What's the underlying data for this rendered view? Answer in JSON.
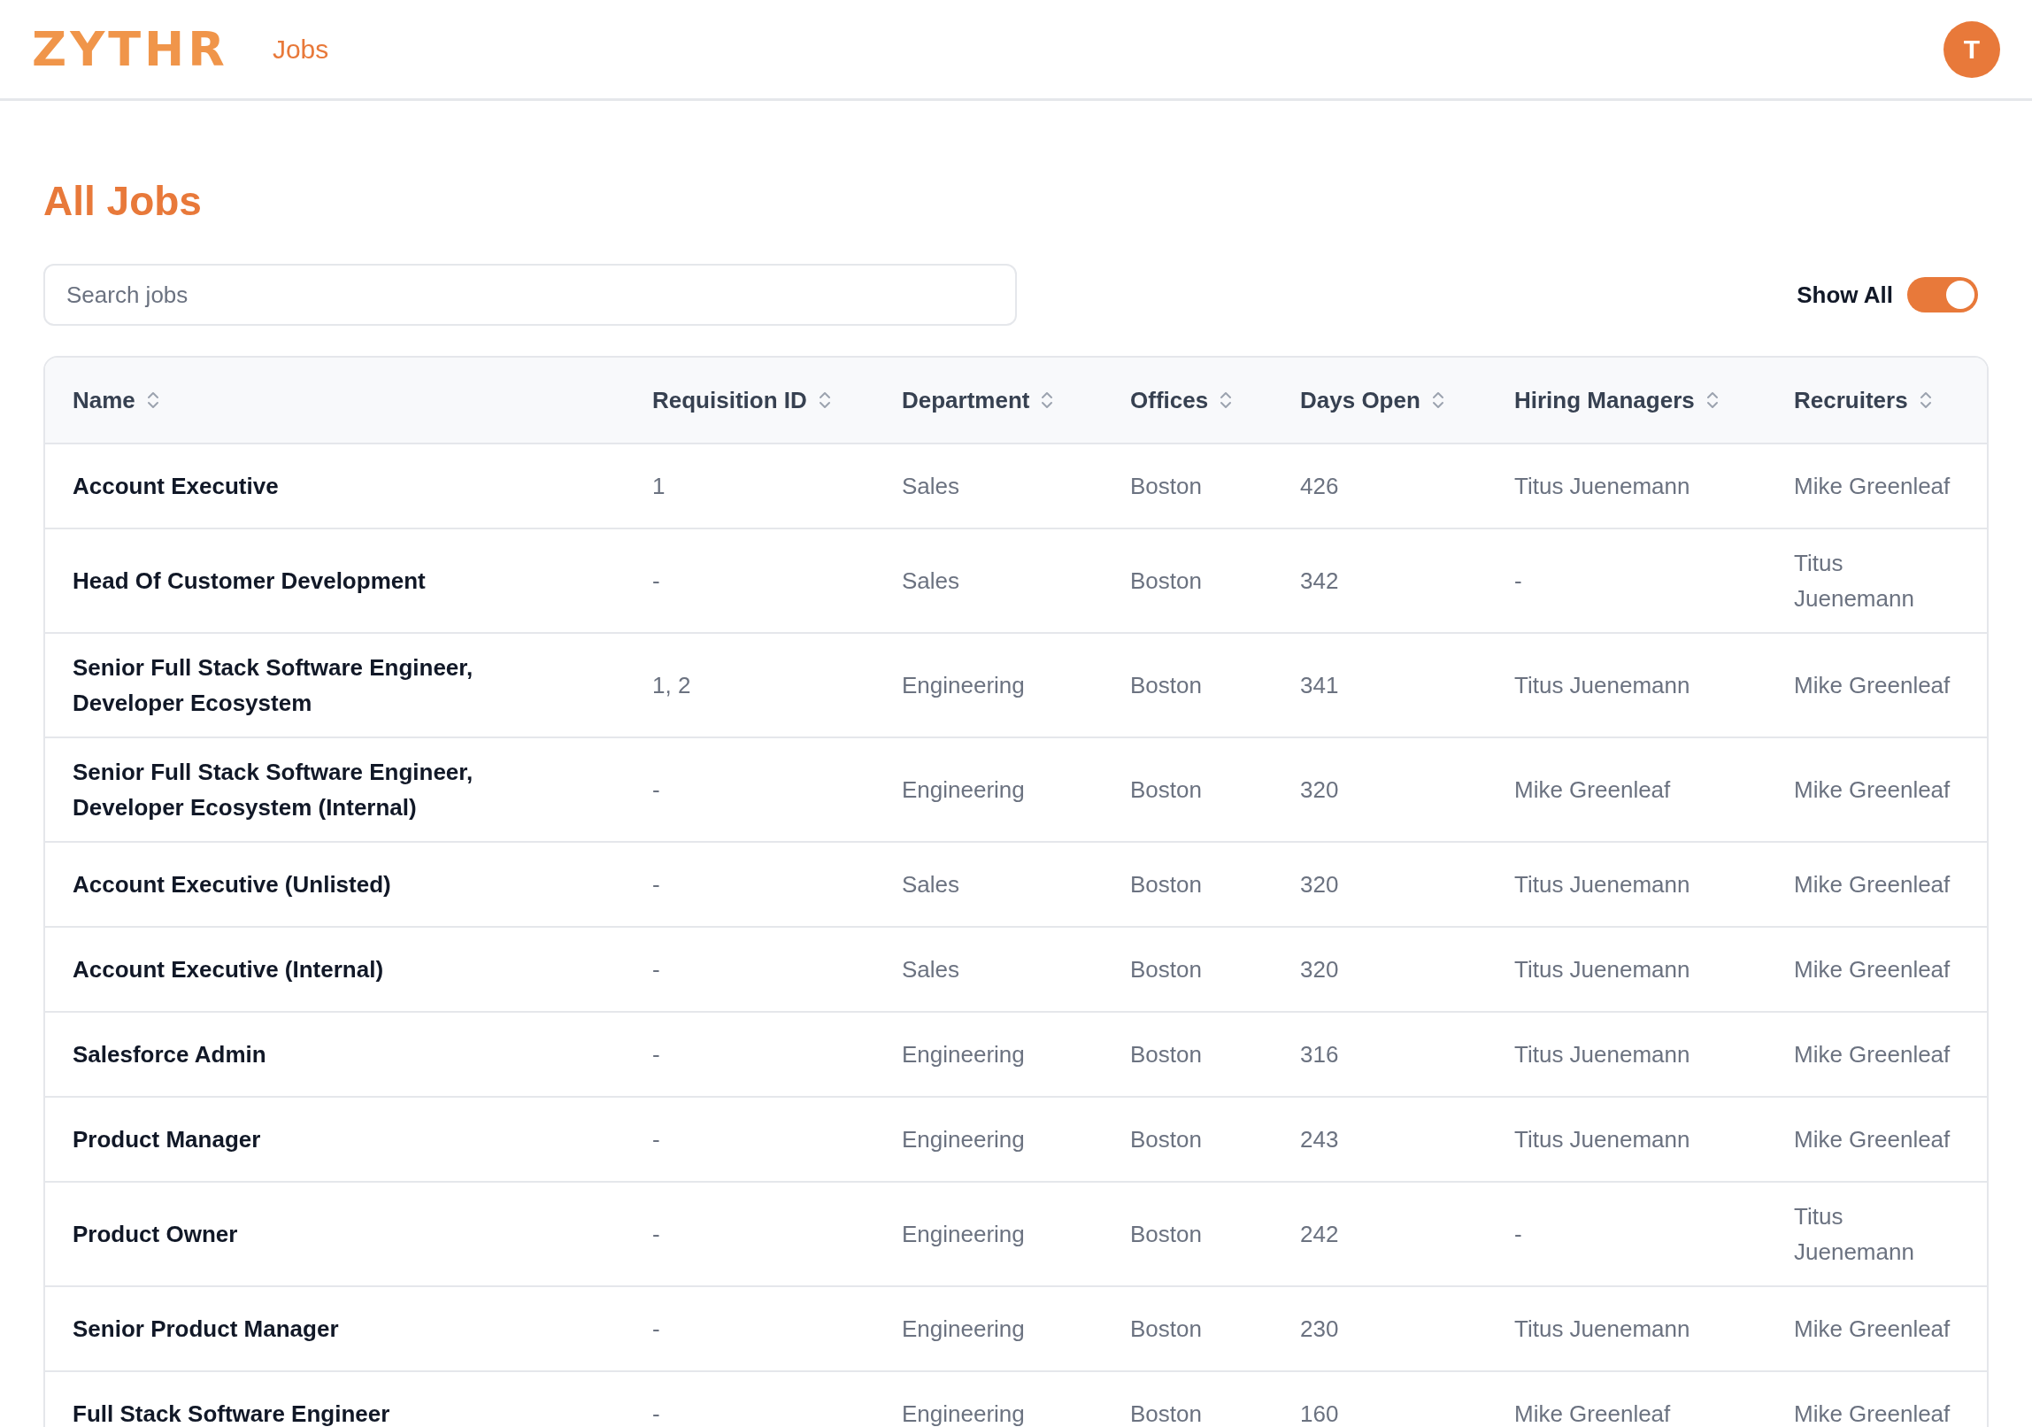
{
  "header": {
    "logo": "ZYTHR",
    "nav": [
      {
        "label": "Jobs",
        "selected": true
      }
    ],
    "avatar": "T"
  },
  "title": "All Jobs",
  "search": {
    "placeholder": "Search jobs"
  },
  "show_all": {
    "label": "Show All",
    "on": true
  },
  "table": {
    "columns": [
      "Name",
      "Requisition ID",
      "Department",
      "Offices",
      "Days Open",
      "Hiring Managers",
      "Recruiters"
    ],
    "rows": [
      [
        "Account Executive",
        "1",
        "Sales",
        "Boston",
        "426",
        "Titus Juenemann",
        "Mike Greenleaf"
      ],
      [
        "Head Of Customer Development",
        "-",
        "Sales",
        "Boston",
        "342",
        "-",
        "Titus Juenemann"
      ],
      [
        "Senior Full Stack Software Engineer, Developer Ecosystem",
        "1, 2",
        "Engineering",
        "Boston",
        "341",
        "Titus Juenemann",
        "Mike Greenleaf"
      ],
      [
        "Senior Full Stack Software Engineer, Developer Ecosystem (Internal)",
        "-",
        "Engineering",
        "Boston",
        "320",
        "Mike Greenleaf",
        "Mike Greenleaf"
      ],
      [
        "Account Executive (Unlisted)",
        "-",
        "Sales",
        "Boston",
        "320",
        "Titus Juenemann",
        "Mike Greenleaf"
      ],
      [
        "Account Executive (Internal)",
        "-",
        "Sales",
        "Boston",
        "320",
        "Titus Juenemann",
        "Mike Greenleaf"
      ],
      [
        "Salesforce Admin",
        "-",
        "Engineering",
        "Boston",
        "316",
        "Titus Juenemann",
        "Mike Greenleaf"
      ],
      [
        "Product Manager",
        "-",
        "Engineering",
        "Boston",
        "243",
        "Titus Juenemann",
        "Mike Greenleaf"
      ],
      [
        "Product Owner",
        "-",
        "Engineering",
        "Boston",
        "242",
        "-",
        "Titus Juenemann"
      ],
      [
        "Senior Product Manager",
        "-",
        "Engineering",
        "Boston",
        "230",
        "Titus Juenemann",
        "Mike Greenleaf"
      ],
      [
        "Full Stack Software Engineer",
        "-",
        "Engineering",
        "Boston",
        "160",
        "Mike Greenleaf",
        "Mike Greenleaf"
      ]
    ]
  }
}
